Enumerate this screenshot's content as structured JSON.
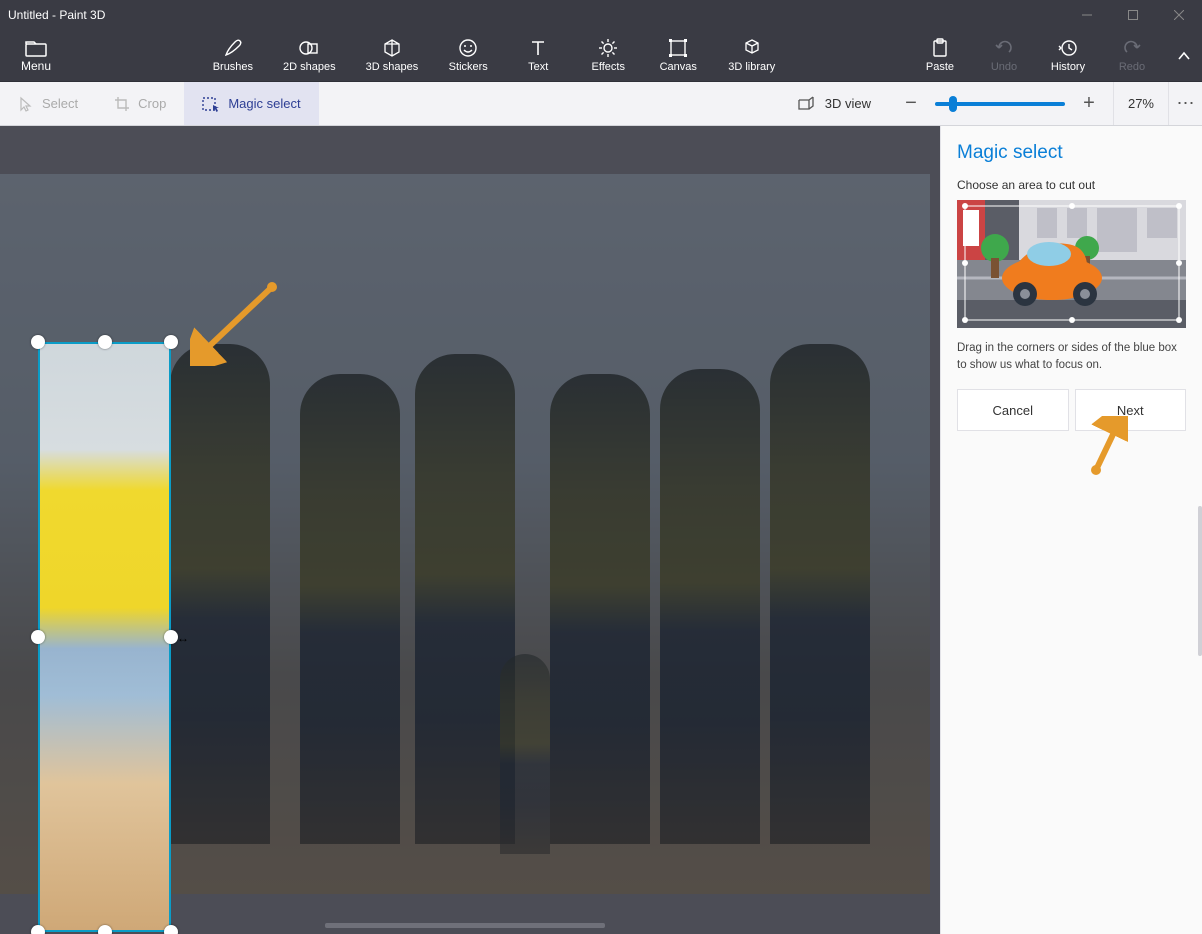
{
  "window": {
    "title": "Untitled - Paint 3D"
  },
  "menu": {
    "label": "Menu"
  },
  "tools": {
    "brushes": "Brushes",
    "shapes2d": "2D shapes",
    "shapes3d": "3D shapes",
    "stickers": "Stickers",
    "text": "Text",
    "effects": "Effects",
    "canvas": "Canvas",
    "library3d": "3D library"
  },
  "right_tools": {
    "paste": "Paste",
    "undo": "Undo",
    "history": "History",
    "redo": "Redo"
  },
  "subbar": {
    "select": "Select",
    "crop": "Crop",
    "magic_select": "Magic select",
    "view3d": "3D view",
    "zoom_pct": "27%"
  },
  "sidebar": {
    "title": "Magic select",
    "hint": "Choose an area to cut out",
    "desc": "Drag in the corners or sides of the blue box to show us what to focus on.",
    "cancel": "Cancel",
    "next": "Next"
  }
}
